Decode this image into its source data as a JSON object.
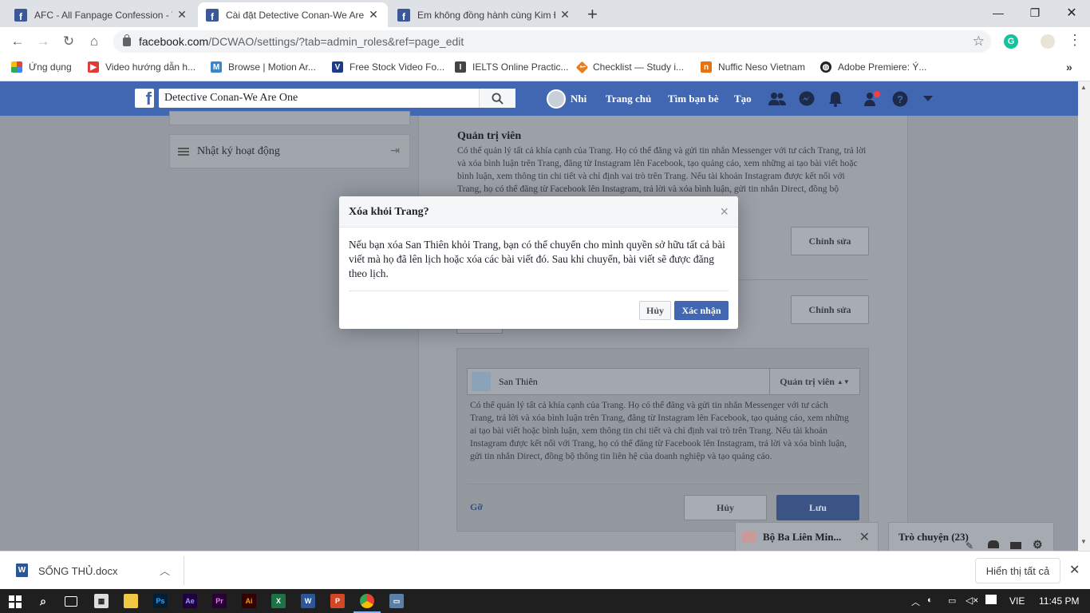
{
  "browser": {
    "tabs": [
      {
        "title": "AFC - All Fanpage Confession - Tr",
        "active": false
      },
      {
        "title": "Cài đặt Detective Conan-We Are",
        "active": true
      },
      {
        "title": "Em không đồng hành cùng Kim Đ",
        "active": false
      }
    ],
    "new_tab_label": "+",
    "url_host": "facebook.com",
    "url_path": "/DCWAO/settings/?tab=admin_roles&ref=page_edit",
    "bookmarks": [
      {
        "label": "Ứng dụng",
        "icon": "apps-grid-icon",
        "color": "#ea4335"
      },
      {
        "label": "Video hướng dẫn h...",
        "icon": "video-icon",
        "color": "#e53935"
      },
      {
        "label": "Browse | Motion Ar...",
        "icon": "motion-array-icon",
        "color": "#3a86c8"
      },
      {
        "label": "Free Stock Video Fo...",
        "icon": "videvo-icon",
        "color": "#1e3a8a"
      },
      {
        "label": "IELTS Online Practic...",
        "icon": "ielts-icon",
        "color": "#444444"
      },
      {
        "label": "Checklist — Study i...",
        "icon": "checklist-icon",
        "color": "#e67e22"
      },
      {
        "label": "Nuffic Neso Vietnam",
        "icon": "nuffic-icon",
        "color": "#e8730c"
      },
      {
        "label": "Adobe Premiere: Ý...",
        "icon": "globe-icon",
        "color": "#202124"
      }
    ]
  },
  "facebook": {
    "search_value": "Detective Conan-We Are One",
    "nav": {
      "profile_name": "Nhi",
      "home": "Trang chủ",
      "find_friends": "Tìm bạn bè",
      "create": "Tạo"
    }
  },
  "sidebar": {
    "activity_log": "Nhật ký hoạt động"
  },
  "roles": {
    "admin_title": "Quản trị viên",
    "admin_desc": "Có thể quản lý tất cả khía cạnh của Trang. Họ có thể đăng và gửi tin nhắn Messenger với tư cách Trang, trả lời và xóa bình luận trên Trang, đăng từ Instagram lên Facebook, tạo quảng cáo, xem những ai tạo bài viết hoặc bình luận, xem thông tin chi tiết và chỉ định vai trò trên Trang. Nếu tài khoản Instagram được kết nối với Trang, họ có thể đăng từ Facebook lên Instagram, trả lời và xóa bình luận, gửi tin nhắn Direct, đồng bộ",
    "edit_label": "Chỉnh sửa",
    "edit_label_2": "Chỉnh sửa",
    "member_name": "San Thiên",
    "member_role": "Quản trị viên",
    "member_desc": "Có thể quản lý tất cả khía cạnh của Trang. Họ có thể đăng và gửi tin nhắn Messenger với tư cách Trang, trả lời và xóa bình luận trên Trang, đăng từ Instagram lên Facebook, tạo quảng cáo, xem những ai tạo bài viết hoặc bình luận, xem thông tin chi tiết và chỉ định vai trò trên Trang. Nếu tài khoản Instagram được kết nối với Trang, họ có thể đăng từ Facebook lên Instagram, trả lời và xóa bình luận, gửi tin nhắn Direct, đồng bộ thông tin liên hệ của doanh nghiệp và tạo quảng cáo.",
    "remove_link": "Gỡ",
    "cancel_label": "Hủy",
    "save_label": "Lưu"
  },
  "dialog": {
    "title": "Xóa khỏi Trang?",
    "close_glyph": "×",
    "body": "Nếu bạn xóa San Thiên khỏi Trang, bạn có thể chuyển cho mình quyền sở hữu tất cả bài viết mà họ đã lên lịch hoặc xóa các bài viết đó. Sau khi chuyển, bài viết sẽ được đăng theo lịch.",
    "cancel_label": "Hủy",
    "confirm_label": "Xác nhận"
  },
  "chat": {
    "group_name": "Bộ Ba Liên Min...",
    "chat_label": "Trò chuyện (23)"
  },
  "download": {
    "file_name": "SỐNG THỦ.docx",
    "show_all": "Hiển thị tất cả"
  },
  "taskbar": {
    "lang": "VIE",
    "time": "11:45 PM"
  },
  "colors": {
    "fb_blue": "#4267b2",
    "dim_overlay": "#959aa2"
  }
}
